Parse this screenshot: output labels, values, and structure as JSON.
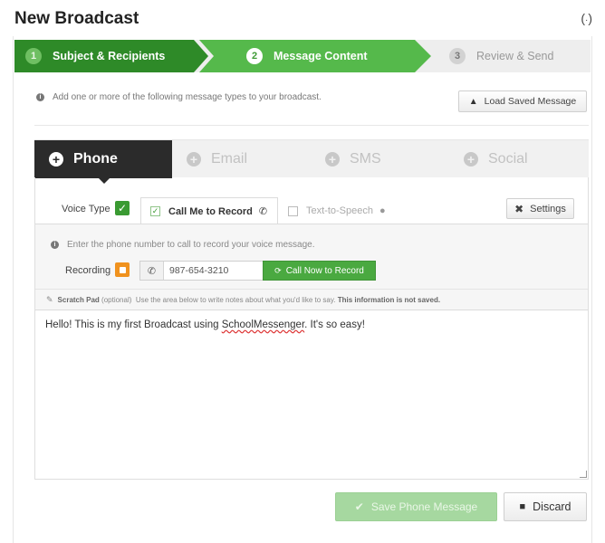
{
  "header": {
    "title": "New Broadcast"
  },
  "wizard": {
    "steps": [
      {
        "num": "1",
        "label": "Subject & Recipients"
      },
      {
        "num": "2",
        "label": "Message Content"
      },
      {
        "num": "3",
        "label": "Review & Send"
      }
    ]
  },
  "info": {
    "text": "Add one or more of the following message types to your broadcast.",
    "load_label": "Load Saved Message"
  },
  "tabs": [
    {
      "label": "Phone"
    },
    {
      "label": "Email"
    },
    {
      "label": "SMS"
    },
    {
      "label": "Social"
    }
  ],
  "phone": {
    "voice_type_label": "Voice Type",
    "call_me_label": "Call Me to Record",
    "tts_label": "Text-to-Speech",
    "settings_label": "Settings",
    "hint": "Enter the phone number to call to record your voice message.",
    "recording_label": "Recording",
    "phone_value": "987-654-3210",
    "call_now_label": "Call Now to Record"
  },
  "scratch": {
    "title": "Scratch Pad",
    "optional": "(optional)",
    "description": "Use the area below to write notes about what you'd like to say.",
    "warning": "This information is not saved.",
    "text_before": "Hello! This is my first Broadcast using ",
    "text_misspelled": "SchoolMessenger",
    "text_after": ". It's so easy!"
  },
  "actions": {
    "save_label": "Save Phone Message",
    "discard_label": "Discard"
  },
  "colors": {
    "step_done": "#2e8a28",
    "step_active": "#55b94b",
    "tab_active": "#2b2b2b",
    "recording": "#f0921e"
  }
}
